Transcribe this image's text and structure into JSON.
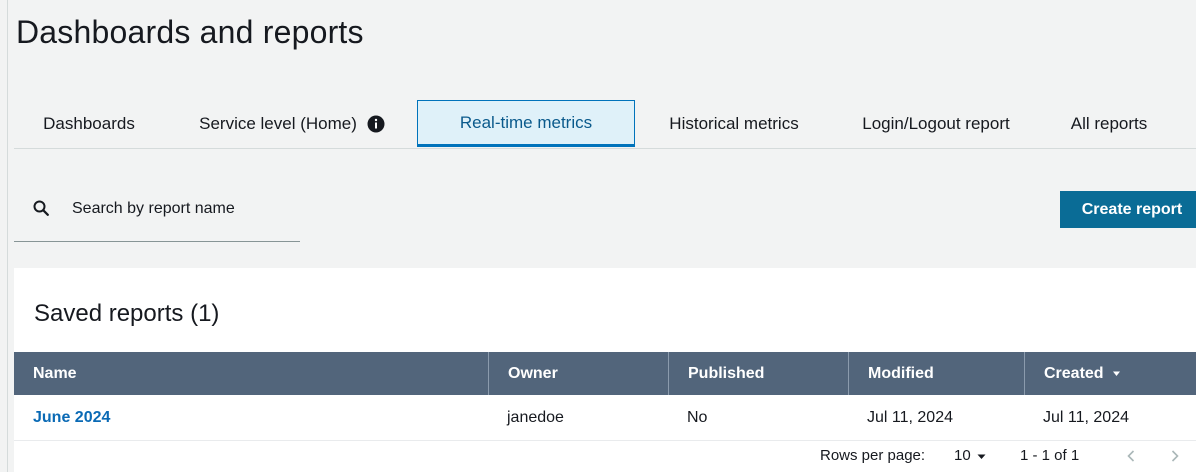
{
  "page": {
    "title": "Dashboards and reports"
  },
  "tabs": [
    {
      "label": "Dashboards",
      "active": false
    },
    {
      "label": "Service level (Home)",
      "active": false,
      "icon": "info-icon"
    },
    {
      "label": "Real-time metrics",
      "active": true
    },
    {
      "label": "Historical metrics",
      "active": false
    },
    {
      "label": "Login/Logout report",
      "active": false
    },
    {
      "label": "All reports",
      "active": false
    }
  ],
  "search": {
    "placeholder": "Search by report name",
    "value": "",
    "icon": "search-icon"
  },
  "toolbar": {
    "create_label": "Create report"
  },
  "saved_reports": {
    "title": "Saved reports (1)",
    "columns": [
      {
        "label": "Name"
      },
      {
        "label": "Owner"
      },
      {
        "label": "Published"
      },
      {
        "label": "Modified"
      },
      {
        "label": "Created",
        "sort": "descending",
        "icon": "sort-down-icon"
      }
    ],
    "rows": [
      {
        "name": "June 2024",
        "owner": "janedoe",
        "published": "No",
        "modified": "Jul 11, 2024",
        "created": "Jul 11, 2024"
      }
    ]
  },
  "pagination": {
    "rows_per_page_label": "Rows per page:",
    "rows_per_page_value": "10",
    "range": "1 - 1 of 1",
    "prev_icon": "chevron-left-icon",
    "next_icon": "chevron-right-icon"
  },
  "colors": {
    "accent": "#0073bb",
    "active_tab_bg": "#dff1f9",
    "button_bg": "#0a6c96",
    "table_header_bg": "#52657b",
    "link": "#0a6ab5",
    "page_bg": "#f2f3f3"
  }
}
